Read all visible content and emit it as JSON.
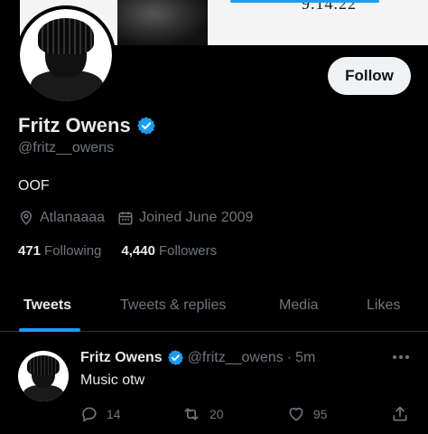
{
  "banner": {
    "date_text": "9.14.22"
  },
  "profile": {
    "name": "Fritz Owens",
    "handle": "@fritz__owens",
    "bio": "OOF",
    "location": "Atlanaaaa",
    "joined": "Joined June 2009",
    "following_count": "471",
    "following_label": "Following",
    "followers_count": "4,440",
    "followers_label": "Followers",
    "follow_button": "Follow",
    "verified_color": "#1d9bf0"
  },
  "tabs": [
    {
      "label": "Tweets",
      "active": true
    },
    {
      "label": "Tweets & replies",
      "active": false
    },
    {
      "label": "Media",
      "active": false
    },
    {
      "label": "Likes",
      "active": false
    }
  ],
  "tweet": {
    "name": "Fritz Owens",
    "handle": "@fritz__owens",
    "separator": "·",
    "time": "5m",
    "text": "Music otw",
    "replies": "14",
    "retweets": "20",
    "likes": "95",
    "icons": [
      "reply-icon",
      "retweet-icon",
      "like-icon",
      "share-icon",
      "more-icon"
    ]
  },
  "colors": {
    "accent": "#1d9bf0",
    "background": "#000000",
    "muted": "#71767b"
  }
}
